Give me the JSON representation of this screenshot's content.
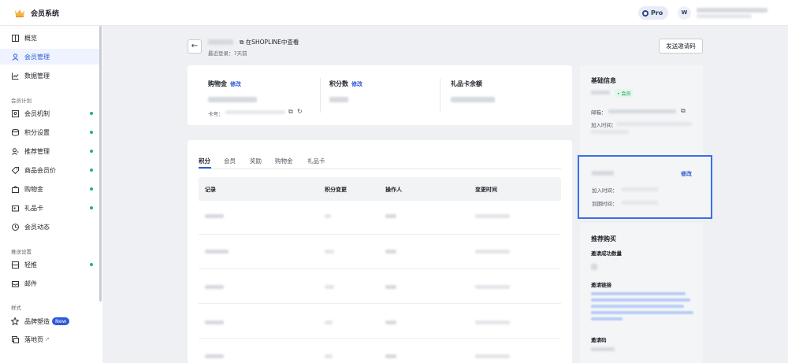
{
  "app": {
    "title": "会员系统",
    "plan_badge": "Pro",
    "avatar_initial": "W"
  },
  "sidebar": {
    "items": [
      {
        "label": "概览",
        "icon": "overview-icon"
      },
      {
        "label": "会员管理",
        "icon": "user-icon",
        "active": true
      },
      {
        "label": "数据管理",
        "icon": "chart-icon"
      }
    ],
    "section_program": "会员计划",
    "program_items": [
      {
        "label": "会员机制",
        "icon": "member-mechanism-icon",
        "dot": true
      },
      {
        "label": "积分设置",
        "icon": "points-icon",
        "dot": true
      },
      {
        "label": "推荐管理",
        "icon": "referral-icon",
        "dot": true
      },
      {
        "label": "商品会员价",
        "icon": "tag-icon",
        "dot": true
      },
      {
        "label": "购物金",
        "icon": "wallet-icon",
        "dot": true
      },
      {
        "label": "礼品卡",
        "icon": "gift-card-icon",
        "dot": true
      },
      {
        "label": "会员动态",
        "icon": "clock-icon",
        "dot": false
      }
    ],
    "section_push": "推送设置",
    "push_items": [
      {
        "label": "轻推",
        "icon": "nudge-icon",
        "dot": true
      },
      {
        "label": "邮件",
        "icon": "mail-icon",
        "dot": false
      }
    ],
    "section_style": "样式",
    "style_items": [
      {
        "label": "品牌塑造",
        "icon": "star-icon",
        "badge": "New"
      },
      {
        "label": "落地页",
        "icon": "landing-page-icon"
      }
    ]
  },
  "header": {
    "shopline_link": "在SHOPLINE中查看",
    "last_login": "最近登录：7天前",
    "invite_button": "发送邀请码"
  },
  "stats": {
    "shopping_credit_label": "购物金",
    "points_label": "积分数",
    "gift_card_label": "礼品卡余额",
    "edit_label": "修改",
    "card_no_label": "卡号："
  },
  "tabs": [
    "积分",
    "会员",
    "奖励",
    "购物金",
    "礼品卡"
  ],
  "table": {
    "columns": [
      "记录",
      "积分变更",
      "操作人",
      "变更时间"
    ],
    "row_count": 5
  },
  "basic_info": {
    "title": "基础信息",
    "member_tag": "• 会员",
    "email_label": "邮箱：",
    "join_label": "加入时间："
  },
  "membership": {
    "edit_label": "修改",
    "join_label": "加入时间：",
    "expire_label": "到期时间："
  },
  "referral": {
    "title": "推荐购买",
    "success_count_label": "邀请成功数量",
    "invite_link_label": "邀请链接",
    "invite_code_label": "邀请码"
  },
  "colors": {
    "accent": "#2e5bd8",
    "dot": "#22b473",
    "highlight": "#3a6fe8"
  }
}
